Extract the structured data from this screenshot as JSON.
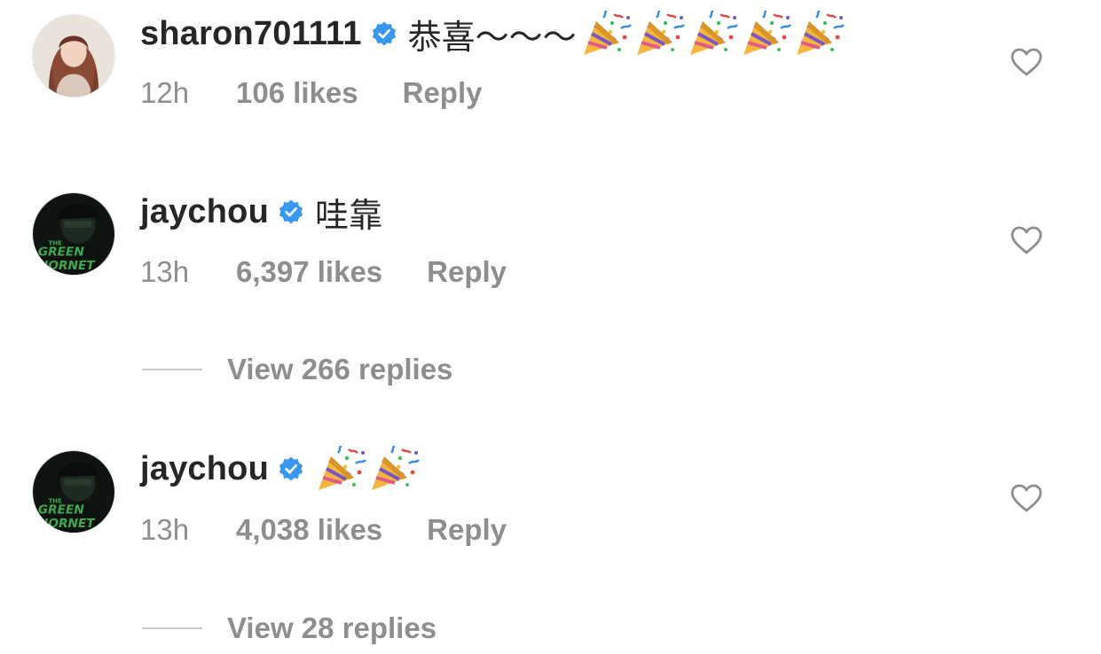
{
  "comments": [
    {
      "username": "sharon701111",
      "verified": true,
      "text": "恭喜～～～",
      "emojis": [
        "party-popper",
        "party-popper",
        "party-popper",
        "party-popper",
        "party-popper"
      ],
      "time": "12h",
      "likes": "106 likes",
      "reply_label": "Reply",
      "view_replies": null
    },
    {
      "username": "jaychou",
      "verified": true,
      "text": "哇靠",
      "emojis": [],
      "time": "13h",
      "likes": "6,397 likes",
      "reply_label": "Reply",
      "view_replies": "View 266 replies"
    },
    {
      "username": "jaychou",
      "verified": true,
      "text": "",
      "emojis": [
        "party-popper",
        "party-popper"
      ],
      "time": "13h",
      "likes": "4,038 likes",
      "reply_label": "Reply",
      "view_replies": "View 28 replies"
    }
  ],
  "avatar_logo_text": [
    "THE",
    "GREEN",
    "HORNET"
  ],
  "colors": {
    "text": "#262626",
    "muted": "#8e8e8e",
    "verified_blue": "#3897f0",
    "divider": "#c7c7c7"
  }
}
